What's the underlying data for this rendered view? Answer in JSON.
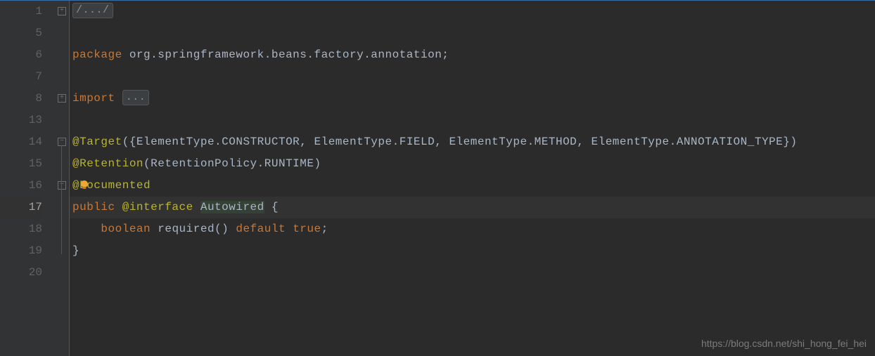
{
  "watermark": "https://blog.csdn.net/shi_hong_fei_hei",
  "lines": [
    {
      "num": "1",
      "fold": "plus",
      "current": false,
      "tokens": [
        {
          "t": "folded",
          "v": "/.../"
        }
      ]
    },
    {
      "num": "5",
      "fold": "",
      "current": false,
      "tokens": []
    },
    {
      "num": "6",
      "fold": "",
      "current": false,
      "tokens": [
        {
          "t": "kw",
          "v": "package"
        },
        {
          "t": "punc",
          "v": " "
        },
        {
          "t": "pkg",
          "v": "org.springframework.beans.factory.annotation"
        },
        {
          "t": "punc",
          "v": ";"
        }
      ]
    },
    {
      "num": "7",
      "fold": "",
      "current": false,
      "tokens": []
    },
    {
      "num": "8",
      "fold": "plus",
      "current": false,
      "tokens": [
        {
          "t": "kw",
          "v": "import"
        },
        {
          "t": "punc",
          "v": " "
        },
        {
          "t": "folded",
          "v": "..."
        }
      ]
    },
    {
      "num": "13",
      "fold": "",
      "current": false,
      "tokens": []
    },
    {
      "num": "14",
      "fold": "minus",
      "current": false,
      "tokens": [
        {
          "t": "ann",
          "v": "@Target"
        },
        {
          "t": "punc",
          "v": "({"
        },
        {
          "t": "type",
          "v": "ElementType"
        },
        {
          "t": "punc",
          "v": "."
        },
        {
          "t": "cls",
          "v": "CONSTRUCTOR"
        },
        {
          "t": "punc",
          "v": ", "
        },
        {
          "t": "type",
          "v": "ElementType"
        },
        {
          "t": "punc",
          "v": "."
        },
        {
          "t": "cls",
          "v": "FIELD"
        },
        {
          "t": "punc",
          "v": ", "
        },
        {
          "t": "type",
          "v": "ElementType"
        },
        {
          "t": "punc",
          "v": "."
        },
        {
          "t": "cls",
          "v": "METHOD"
        },
        {
          "t": "punc",
          "v": ", "
        },
        {
          "t": "type",
          "v": "ElementType"
        },
        {
          "t": "punc",
          "v": "."
        },
        {
          "t": "cls",
          "v": "ANNOTATION_TYPE"
        },
        {
          "t": "punc",
          "v": "})"
        }
      ]
    },
    {
      "num": "15",
      "fold": "",
      "current": false,
      "tokens": [
        {
          "t": "ann",
          "v": "@Retention"
        },
        {
          "t": "punc",
          "v": "("
        },
        {
          "t": "type",
          "v": "RetentionPolicy"
        },
        {
          "t": "punc",
          "v": "."
        },
        {
          "t": "cls",
          "v": "RUNTIME"
        },
        {
          "t": "punc",
          "v": ")"
        }
      ]
    },
    {
      "num": "16",
      "fold": "minus",
      "current": false,
      "bulb": true,
      "tokens": [
        {
          "t": "ann",
          "v": "@Documented"
        }
      ]
    },
    {
      "num": "17",
      "fold": "",
      "current": true,
      "tokens": [
        {
          "t": "kw",
          "v": "public"
        },
        {
          "t": "punc",
          "v": " "
        },
        {
          "t": "ann",
          "v": "@interface"
        },
        {
          "t": "punc",
          "v": " "
        },
        {
          "t": "hl",
          "v": "Autowired"
        },
        {
          "t": "punc",
          "v": " {"
        }
      ]
    },
    {
      "num": "18",
      "fold": "",
      "current": false,
      "indent": 1,
      "tokens": [
        {
          "t": "kw",
          "v": "boolean"
        },
        {
          "t": "punc",
          "v": " "
        },
        {
          "t": "type",
          "v": "required"
        },
        {
          "t": "punc",
          "v": "() "
        },
        {
          "t": "kw",
          "v": "default"
        },
        {
          "t": "punc",
          "v": " "
        },
        {
          "t": "kw",
          "v": "true"
        },
        {
          "t": "punc",
          "v": ";"
        }
      ]
    },
    {
      "num": "19",
      "fold": "",
      "current": false,
      "tokens": [
        {
          "t": "punc",
          "v": "}"
        }
      ]
    },
    {
      "num": "20",
      "fold": "",
      "current": false,
      "tokens": []
    }
  ]
}
